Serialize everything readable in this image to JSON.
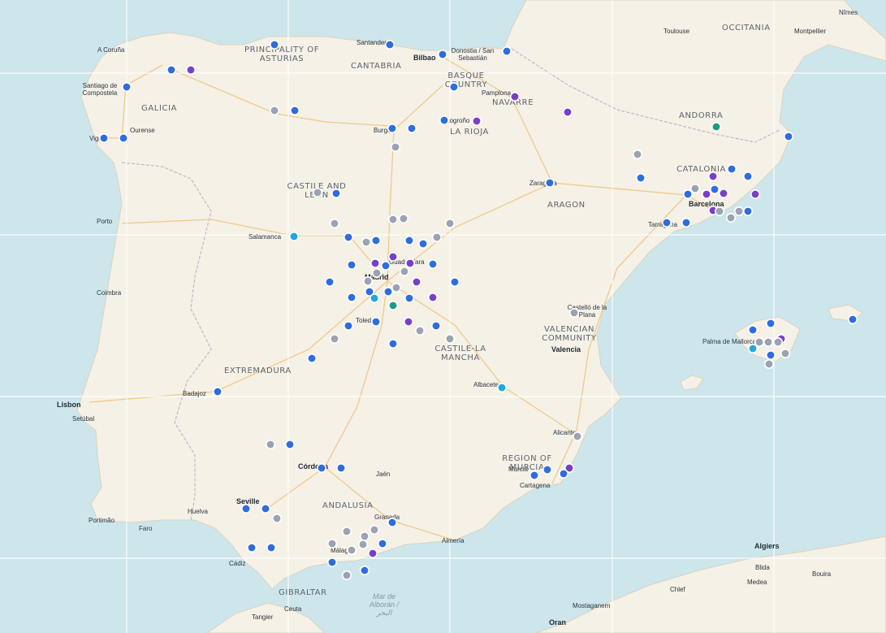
{
  "map": {
    "colors": {
      "sea": "#cde6ec",
      "land": "#f5f1e6",
      "border": "#c4b4cc",
      "road": "#f0c98c",
      "blue_marker": "#2f6ddf",
      "purple_marker": "#7a3fc8",
      "gray_marker": "#9aa3b3",
      "teal_marker": "#1f9a82",
      "cyan_marker": "#22a7dd"
    },
    "regions": [
      "PRINCIPALITY OF ASTURIAS",
      "CANTABRIA",
      "BASQUE COUNTRY",
      "NAVARRE",
      "GALICIA",
      "LA RIOJA",
      "OCCITANIA",
      "ANDORRA",
      "CATALONIA",
      "ARAGON",
      "CASTILE AND LEÓN",
      "VALENCIAN COMMUNITY",
      "CASTILE-LA MANCHA",
      "EXTREMADURA",
      "REGION OF MURCIA",
      "ANDALUSIA",
      "GIBRALTAR"
    ],
    "cities": [
      "A Coruña",
      "Santiago de Compostela",
      "Ourense",
      "Vigo",
      "Santander",
      "Bilbao",
      "Donostia / San Sebastián",
      "Pamplona",
      "Logroño",
      "Burgos",
      "Zaragoza",
      "Toulouse",
      "Montpellier",
      "Nîmes",
      "Barcelona",
      "Tarragona",
      "Porto",
      "Salamanca",
      "Guadalajara",
      "Madrid",
      "Toledo",
      "Coimbra",
      "Castelló de la Plana",
      "Valencia",
      "Palma de Mallorca",
      "Albacete",
      "Badajoz",
      "Lisbon",
      "Setúbal",
      "Alicante",
      "Murcia",
      "Cartagena",
      "Córdoba",
      "Jaén",
      "Seville",
      "Huelva",
      "Portimão",
      "Faro",
      "Granada",
      "Almería",
      "Málaga",
      "Cádiz",
      "Ceuta",
      "Tangier",
      "Algiers",
      "Blida",
      "Medea",
      "Bouira",
      "Chlef",
      "Mostaganem",
      "Oran"
    ],
    "sea_label": "Mar de Alborán / البحر"
  }
}
